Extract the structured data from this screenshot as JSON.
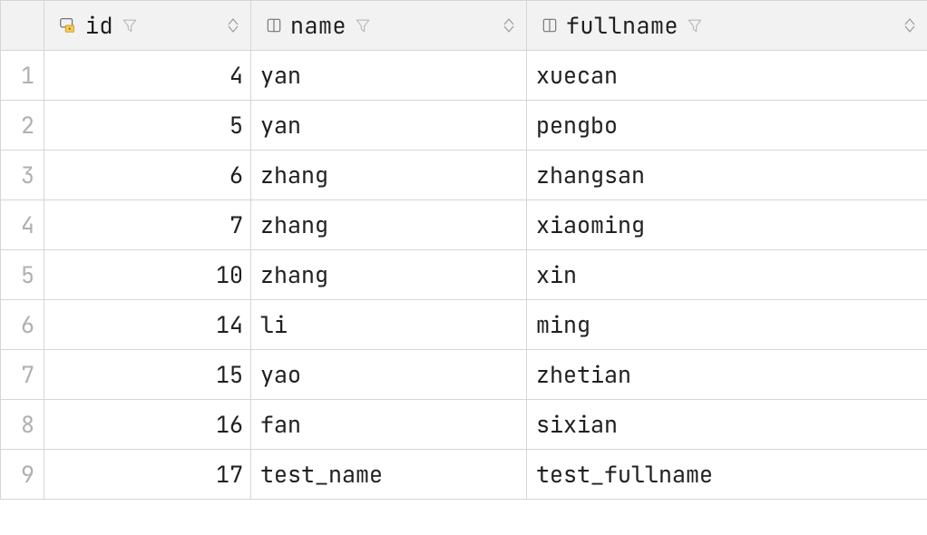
{
  "columns": {
    "id": {
      "label": "id"
    },
    "name": {
      "label": "name"
    },
    "fullname": {
      "label": "fullname"
    }
  },
  "rows": [
    {
      "n": "1",
      "id": "4",
      "name": "yan",
      "fullname": "xuecan"
    },
    {
      "n": "2",
      "id": "5",
      "name": "yan",
      "fullname": "pengbo"
    },
    {
      "n": "3",
      "id": "6",
      "name": "zhang",
      "fullname": "zhangsan"
    },
    {
      "n": "4",
      "id": "7",
      "name": "zhang",
      "fullname": "xiaoming"
    },
    {
      "n": "5",
      "id": "10",
      "name": "zhang",
      "fullname": "xin"
    },
    {
      "n": "6",
      "id": "14",
      "name": "li",
      "fullname": "ming"
    },
    {
      "n": "7",
      "id": "15",
      "name": "yao",
      "fullname": "zhetian"
    },
    {
      "n": "8",
      "id": "16",
      "name": "fan",
      "fullname": "sixian"
    },
    {
      "n": "9",
      "id": "17",
      "name": "test_name",
      "fullname": "test_fullname"
    }
  ]
}
